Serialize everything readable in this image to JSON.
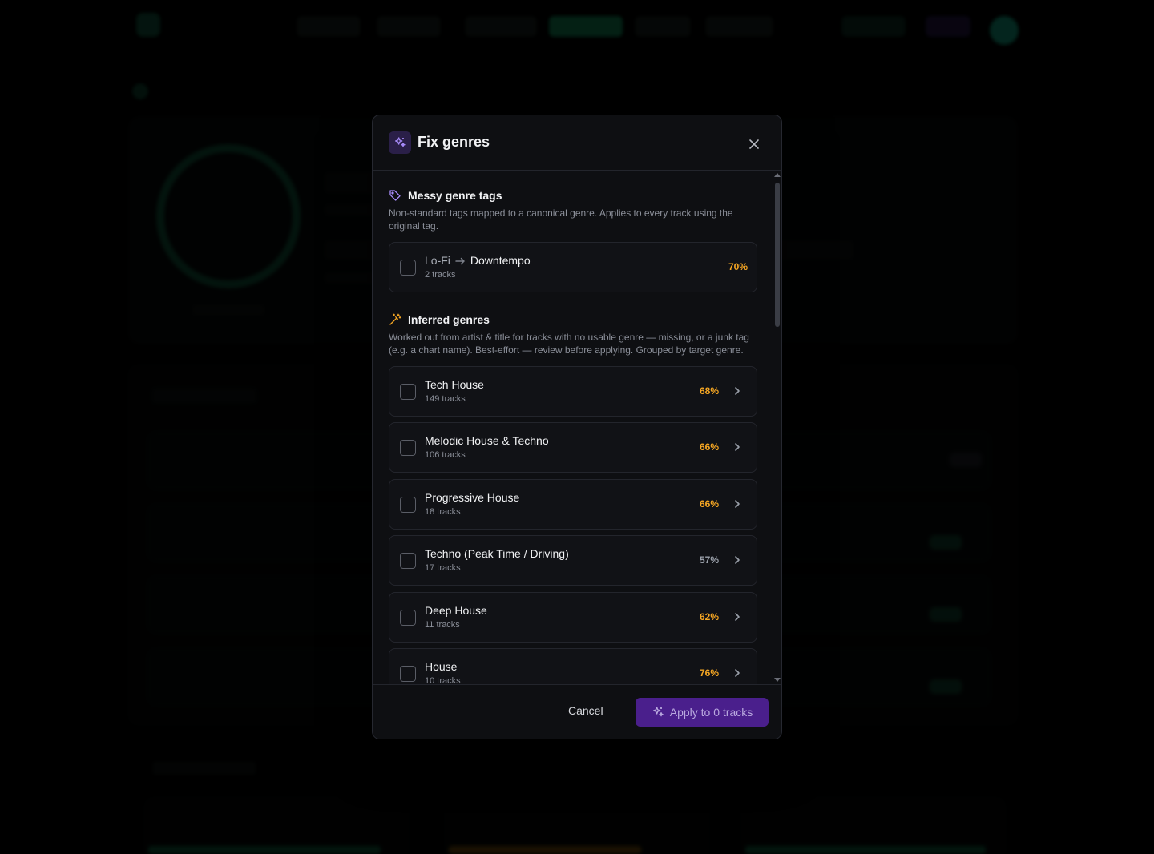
{
  "modal": {
    "title": "Fix genres",
    "close_label": "×",
    "messy_section": {
      "title": "Messy genre tags",
      "description": "Non-standard tags mapped to a canonical genre. Applies to every track using the original tag.",
      "items": [
        {
          "from": "Lo-Fi",
          "to": "Downtempo",
          "tracks": "2 tracks",
          "confidence": "70%"
        }
      ]
    },
    "inferred_section": {
      "title": "Inferred genres",
      "description": "Worked out from artist & title for tracks with no usable genre — missing, or a junk tag (e.g. a chart name). Best-effort — review before applying. Grouped by target genre.",
      "items": [
        {
          "genre": "Tech House",
          "tracks": "149 tracks",
          "confidence": "68%"
        },
        {
          "genre": "Melodic House & Techno",
          "tracks": "106 tracks",
          "confidence": "66%"
        },
        {
          "genre": "Progressive House",
          "tracks": "18 tracks",
          "confidence": "66%"
        },
        {
          "genre": "Techno (Peak Time / Driving)",
          "tracks": "17 tracks",
          "confidence": "57%"
        },
        {
          "genre": "Deep House",
          "tracks": "11 tracks",
          "confidence": "62%"
        },
        {
          "genre": "House",
          "tracks": "10 tracks",
          "confidence": "76%"
        }
      ]
    },
    "footer": {
      "cancel_label": "Cancel",
      "apply_label": "Apply to 0 tracks"
    }
  },
  "colors": {
    "accent_purple": "#4a1f8c",
    "confidence_high": "#f5a623",
    "confidence_low": "#9aa0aa",
    "icon_purple": "#a78bfa",
    "icon_amber": "#f5a623"
  },
  "icons": {
    "header": "sparkles-icon",
    "messy": "tag-icon",
    "inferred": "wand-icon",
    "close": "close-icon",
    "chevron": "chevron-right-icon",
    "arrow": "arrow-right-icon",
    "apply": "sparkles-icon"
  }
}
